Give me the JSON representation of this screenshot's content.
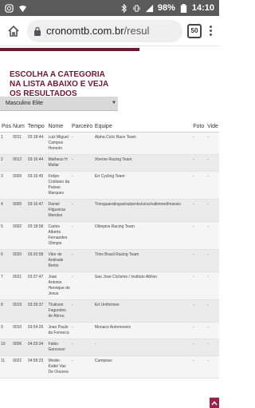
{
  "status_bar": {
    "battery": "98%",
    "time": "14:10",
    "icons": [
      "instagram-icon",
      "wifi-icon",
      "bluetooth-icon",
      "vibrate-icon",
      "signal-icon",
      "battery-icon"
    ]
  },
  "browser": {
    "url_domain": "cronomtb.com.br",
    "url_path": "/resul",
    "tab_count": "50"
  },
  "page": {
    "heading": "ESCOLHA A CATEGORIA NA LISTA ABAIXO E VEJA OS RESULTADOS",
    "category_select": "Masculino Elite",
    "accent_color": "#6d1a33",
    "columns": [
      "Pos",
      "Num",
      "Tempo",
      "Nome",
      "Parceiro",
      "Equipe",
      "Foto",
      "Vide"
    ],
    "rows": [
      {
        "pos": "1",
        "num": "0011",
        "tempo": "03:18:44",
        "nome": "Luiz Miguel Campos Honorio",
        "parceiro": "-",
        "equipe": "Alpha Ciclo Race Team",
        "foto": "-",
        "video": "-"
      },
      {
        "pos": "2",
        "num": "0012",
        "tempo": "03:16:44",
        "nome": "Matheus H Mullar",
        "parceiro": "-",
        "equipe": "Xtreme Racing Team",
        "foto": "-",
        "video": "-"
      },
      {
        "pos": "3",
        "num": "0009",
        "tempo": "03:16:45",
        "nome": "Felipe Cristiano da Paixao Marques",
        "parceiro": "-",
        "equipe": "Ert Cycling Team",
        "foto": "-",
        "video": "-"
      },
      {
        "pos": "4",
        "num": "0005",
        "tempo": "03:16:47",
        "nome": "Daniel Filgueiras Mendes",
        "parceiro": "-",
        "equipe": "Trinxguaratinguetra/penks/uvvs/vallemed/maxxis",
        "foto": "-",
        "video": "-"
      },
      {
        "pos": "5",
        "num": "0002",
        "tempo": "03:18:58",
        "nome": "Carlos Alberto Fernandes Olimpio",
        "parceiro": "-",
        "equipe": "Olimpios Racing Team",
        "foto": "-",
        "video": "-"
      },
      {
        "pos": "6",
        "num": "0020",
        "tempo": "03:20:58",
        "nome": "Vitor de Andrade Bento",
        "parceiro": "-",
        "equipe": "Trinx Brasil Racing Team",
        "foto": "-",
        "video": "-"
      },
      {
        "pos": "7",
        "num": "0021",
        "tempo": "03:37:47",
        "nome": "Joao Antonio Henrique de Jesus",
        "parceiro": "-",
        "equipe": "Sao Jose Ciclismo / Instituto Athlon",
        "foto": "-",
        "video": "-"
      },
      {
        "pos": "8",
        "num": "0019",
        "tempo": "03:39:37",
        "nome": "Thalison Fagundes de Abreu",
        "parceiro": "-",
        "equipe": "Ert Uniformes",
        "foto": "-",
        "video": "-"
      },
      {
        "pos": "9",
        "num": "0010",
        "tempo": "03:54:26",
        "nome": "Joao Paulo da Fonseca",
        "parceiro": "-",
        "equipe": "Monaco Automoveis",
        "foto": "-",
        "video": "-"
      },
      {
        "pos": "10",
        "num": "0006",
        "tempo": "04:29:34",
        "nome": "Fabio Genovezi",
        "parceiro": "-",
        "equipe": "-",
        "foto": "-",
        "video": "-"
      },
      {
        "pos": "11",
        "num": "0022",
        "tempo": "04:58:23",
        "nome": "Weder Kaiké Vaz De Oouvea",
        "parceiro": "-",
        "equipe": "Campeao",
        "foto": "-",
        "video": "-"
      }
    ]
  }
}
